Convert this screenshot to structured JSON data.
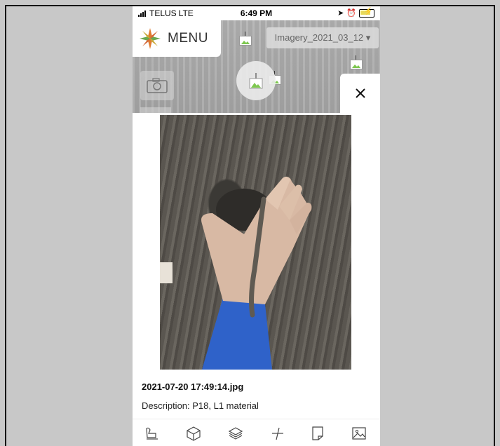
{
  "status_bar": {
    "carrier": "TELUS",
    "network": "LTE",
    "time": "6:49 PM"
  },
  "header": {
    "menu_label": "MENU",
    "imagery_select": "Imagery_2021_03_12 ▾"
  },
  "photo": {
    "filename": "2021-07-20 17:49:14.jpg",
    "description": "Description: P18, L1 material"
  },
  "toolbar": {
    "icons": [
      "draw-icon",
      "cube-icon",
      "layers-icon",
      "measure-icon",
      "note-icon",
      "image-icon"
    ]
  },
  "colors": {
    "accent_green": "#7ec850",
    "logo_orange": "#e07a2e",
    "logo_green": "#6aa84f"
  }
}
